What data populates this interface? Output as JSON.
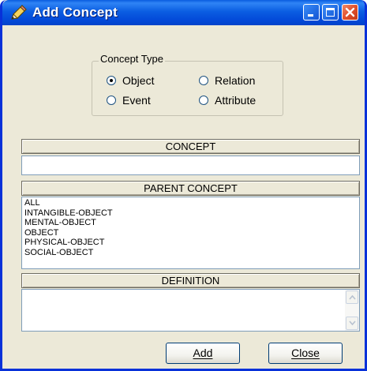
{
  "window": {
    "title": "Add Concept",
    "icon": "pencil-icon",
    "title_bar_color": "#0b5ee2",
    "controls": [
      "minimize-icon",
      "maximize-icon",
      "close-icon"
    ]
  },
  "concept_type": {
    "label": "Concept Type",
    "selected": "Object",
    "options": [
      {
        "label": "Object",
        "checked": true
      },
      {
        "label": "Relation",
        "checked": false
      },
      {
        "label": "Event",
        "checked": false
      },
      {
        "label": "Attribute",
        "checked": false
      }
    ]
  },
  "concept": {
    "header": "CONCEPT",
    "value": ""
  },
  "parent_concept": {
    "header": "PARENT CONCEPT",
    "items": [
      "ALL",
      "INTANGIBLE-OBJECT",
      "MENTAL-OBJECT",
      "OBJECT",
      "PHYSICAL-OBJECT",
      "SOCIAL-OBJECT"
    ]
  },
  "definition": {
    "header": "DEFINITION",
    "value": ""
  },
  "buttons": {
    "add": "Add",
    "close": "Close"
  }
}
